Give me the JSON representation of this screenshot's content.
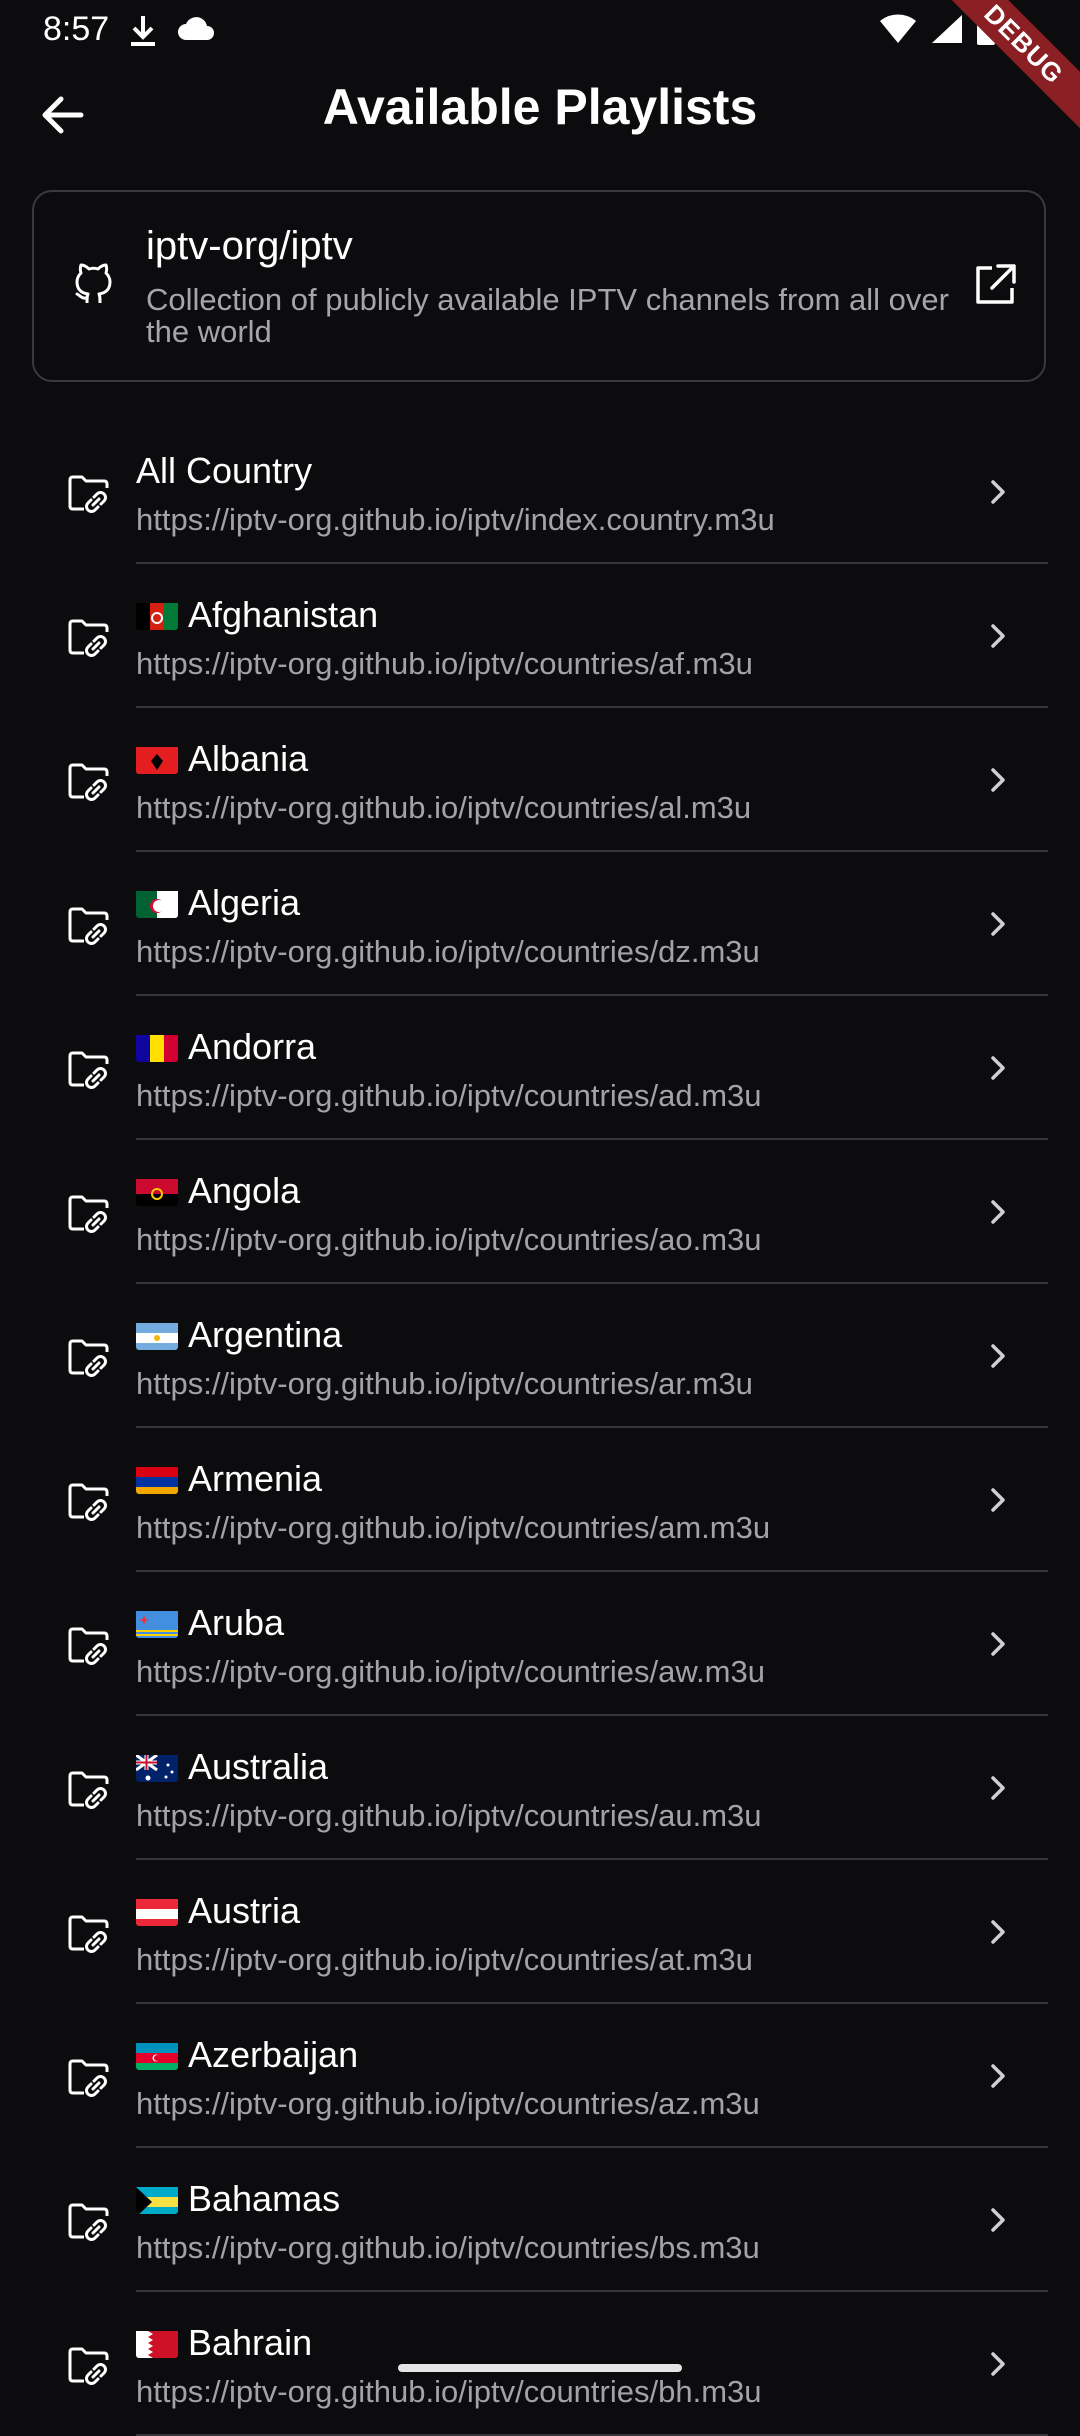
{
  "status_bar": {
    "time": "8:57",
    "left_icons": [
      "download-icon",
      "cloud-icon"
    ],
    "right_icons": [
      "wifi-icon",
      "signal-icon",
      "battery-icon"
    ]
  },
  "debug_banner": "DEBUG",
  "app_bar": {
    "title": "Available Playlists",
    "back_icon": "arrow-back-icon"
  },
  "source": {
    "title": "iptv-org/iptv",
    "description": "Collection of publicly available IPTV channels from all over the world",
    "icon": "github-icon",
    "action_icon": "external-link-icon"
  },
  "playlists": [
    {
      "name": "All Country",
      "flag": "",
      "url": "https://iptv-org.github.io/iptv/index.country.m3u"
    },
    {
      "name": "Afghanistan",
      "flag": "af",
      "url": "https://iptv-org.github.io/iptv/countries/af.m3u"
    },
    {
      "name": "Albania",
      "flag": "al",
      "url": "https://iptv-org.github.io/iptv/countries/al.m3u"
    },
    {
      "name": "Algeria",
      "flag": "dz",
      "url": "https://iptv-org.github.io/iptv/countries/dz.m3u"
    },
    {
      "name": "Andorra",
      "flag": "ad",
      "url": "https://iptv-org.github.io/iptv/countries/ad.m3u"
    },
    {
      "name": "Angola",
      "flag": "ao",
      "url": "https://iptv-org.github.io/iptv/countries/ao.m3u"
    },
    {
      "name": "Argentina",
      "flag": "ar",
      "url": "https://iptv-org.github.io/iptv/countries/ar.m3u"
    },
    {
      "name": "Armenia",
      "flag": "am",
      "url": "https://iptv-org.github.io/iptv/countries/am.m3u"
    },
    {
      "name": "Aruba",
      "flag": "aw",
      "url": "https://iptv-org.github.io/iptv/countries/aw.m3u"
    },
    {
      "name": "Australia",
      "flag": "au",
      "url": "https://iptv-org.github.io/iptv/countries/au.m3u"
    },
    {
      "name": "Austria",
      "flag": "at",
      "url": "https://iptv-org.github.io/iptv/countries/at.m3u"
    },
    {
      "name": "Azerbaijan",
      "flag": "az",
      "url": "https://iptv-org.github.io/iptv/countries/az.m3u"
    },
    {
      "name": "Bahamas",
      "flag": "bs",
      "url": "https://iptv-org.github.io/iptv/countries/bs.m3u"
    },
    {
      "name": "Bahrain",
      "flag": "bh",
      "url": "https://iptv-org.github.io/iptv/countries/bh.m3u"
    }
  ],
  "item_icon": "folder-link-icon",
  "item_chevron": "chevron-right-icon",
  "colors": {
    "background": "#0c0c0e",
    "text_primary": "#ffffff",
    "text_secondary": "#a2a2a8",
    "divider": "#35353a",
    "debug_banner": "#8a1f24"
  }
}
